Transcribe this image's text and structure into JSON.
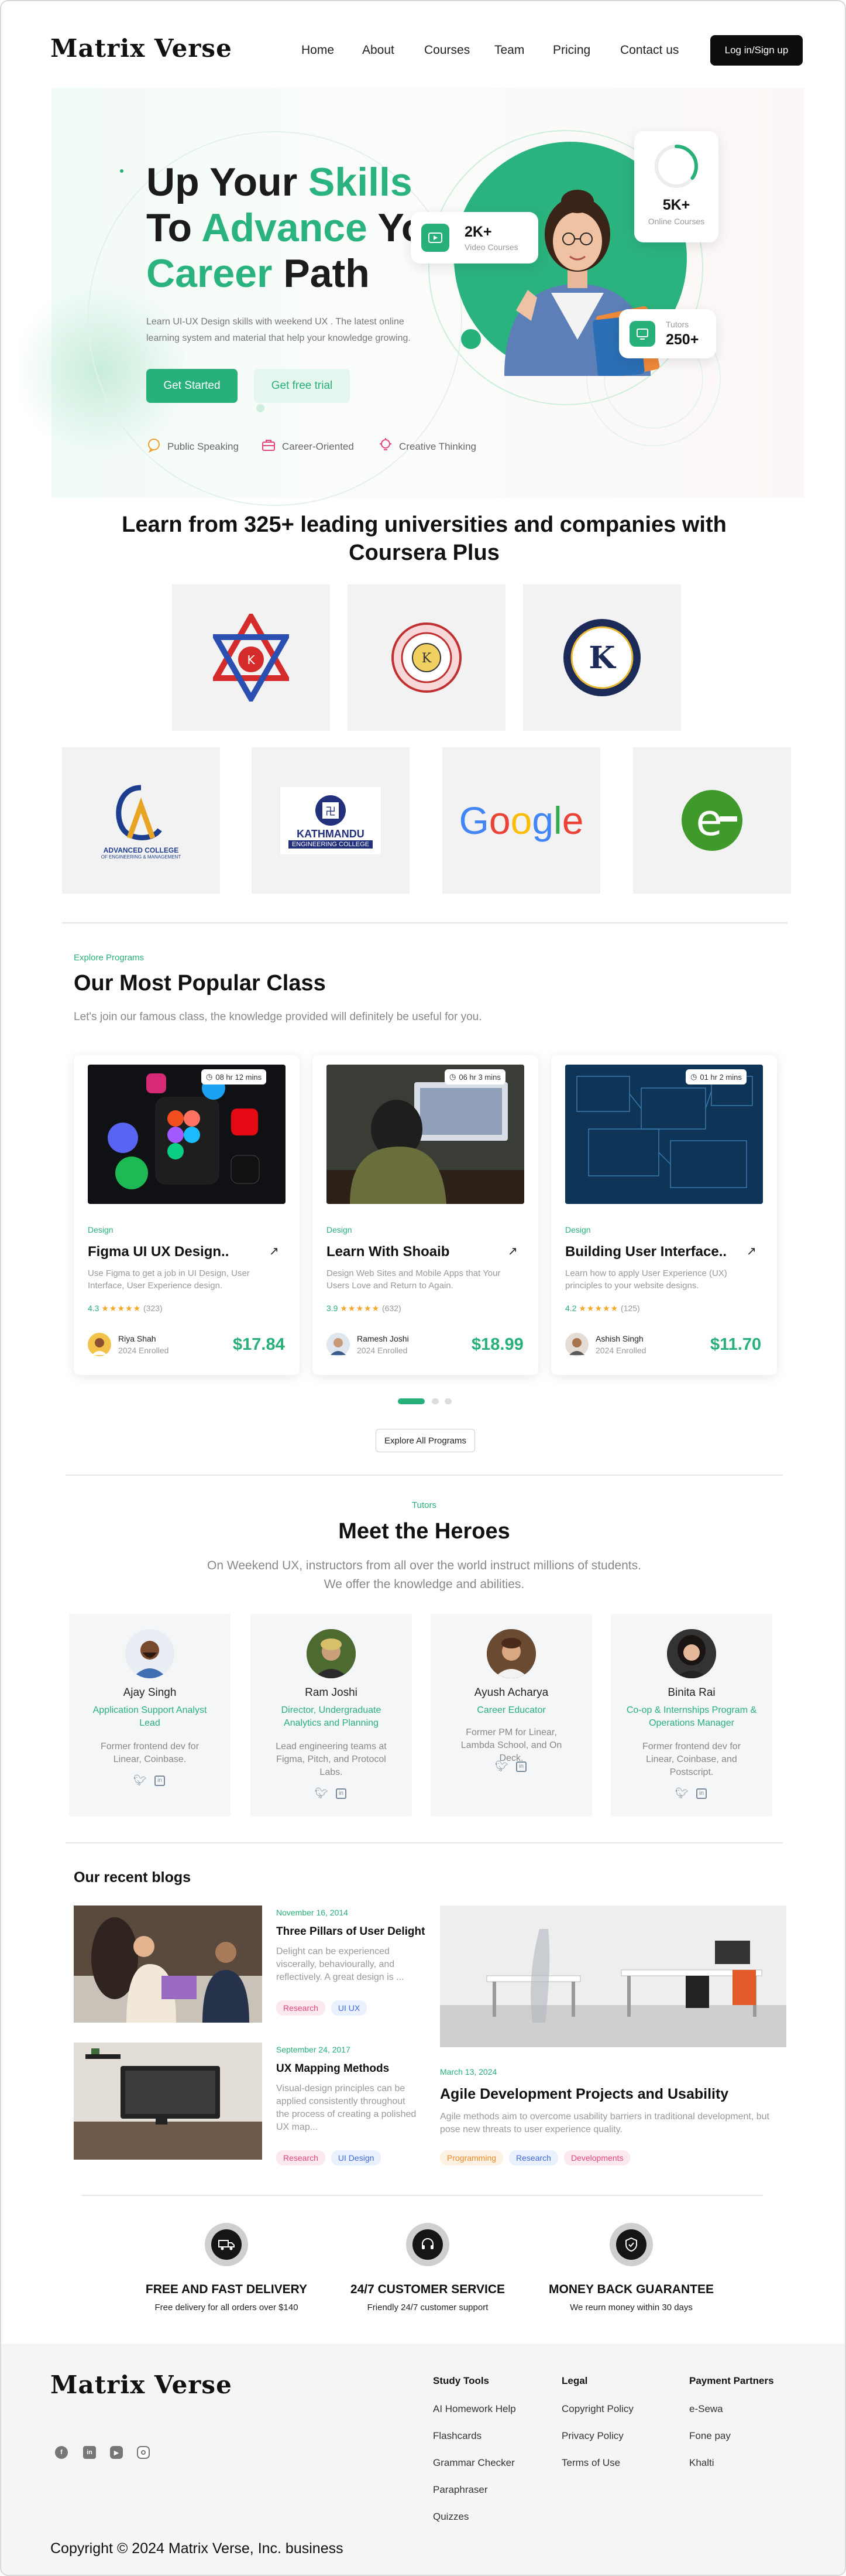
{
  "brand": {
    "logo": "Matrix Verse",
    "accent": "#27b079"
  },
  "nav": {
    "links": [
      "Home",
      "About",
      "Courses",
      "Team",
      "Pricing",
      "Contact us"
    ],
    "login": "Log in/Sign up"
  },
  "hero": {
    "title_l1a": "Up Your ",
    "title_l1b": "Skills",
    "title_l2a": "To ",
    "title_l2b": "Advance",
    "title_l2c": " Your",
    "title_l3a": "Career",
    "title_l3b": " Path",
    "desc": "Learn UI-UX Design skills with weekend UX . The latest online learning system and material that help your knowledge growing.",
    "cta_primary": "Get Started",
    "cta_secondary": "Get free trial",
    "features": [
      "Public Speaking",
      "Career-Oriented",
      "Creative Thinking"
    ],
    "stat_video": {
      "value": "2K+",
      "label": "Video Courses"
    },
    "stat_online": {
      "value": "5K+",
      "label": "Online Courses",
      "progress": 0.35
    },
    "stat_tutors": {
      "value": "250+",
      "label": "Tutors"
    }
  },
  "universities": {
    "title": "Learn from 325+ leading universities and companies with Coursera Plus",
    "logos": [
      "nepal-emblem-logo",
      "university-seal-logo",
      "kantipur-engineering-college-logo",
      "advanced-college-logo",
      "kathmandu-engineering-college-logo",
      "google-logo",
      "e-sewa-logo"
    ],
    "advanced_text": "ADVANCED COLLEGE",
    "advanced_subtext": "OF ENGINEERING & MANAGEMENT",
    "kathmandu_l1": "KATHMANDU",
    "kathmandu_l2": "ENGINEERING COLLEGE",
    "google_text": "Google"
  },
  "programs": {
    "eyebrow": "Explore Programs",
    "title": "Our Most Popular Class",
    "subtitle": "Let's join our famous class, the knowledge provided will definitely be useful for you.",
    "courses": [
      {
        "duration": "08 hr 12 mins",
        "category": "Design",
        "title": "Figma UI UX Design..",
        "desc": "Use Figma to get a job in UI Design, User Interface, User Experience design.",
        "rating": "4.3",
        "stars": "★★★★★",
        "reviews": "(323)",
        "tutor": "Riya Shah",
        "enrolled": "2024 Enrolled",
        "price": "$17.84"
      },
      {
        "duration": "06 hr 3 mins",
        "category": "Design",
        "title": "Learn With Shoaib",
        "desc": "Design Web Sites and Mobile Apps that Your Users Love and Return to Again.",
        "rating": "3.9",
        "stars": "★★★★★",
        "reviews": "(632)",
        "tutor": "Ramesh Joshi",
        "enrolled": "2024 Enrolled",
        "price": "$18.99"
      },
      {
        "duration": "01 hr 2 mins",
        "category": "Design",
        "title": "Building User Interface..",
        "desc": "Learn how to apply User Experience (UX) principles to your website designs.",
        "rating": "4.2",
        "stars": "★★★★★",
        "reviews": "(125)",
        "tutor": "Ashish Singh",
        "enrolled": "2024 Enrolled",
        "price": "$11.70"
      }
    ],
    "explore_btn": "Explore All Programs"
  },
  "tutors": {
    "eyebrow": "Tutors",
    "title": "Meet the Heroes",
    "subtitle_l1": "On Weekend UX, instructors from all over the world instruct millions of students.",
    "subtitle_l2": "We offer the knowledge and abilities.",
    "people": [
      {
        "name": "Ajay Singh",
        "role": "Application Support Analyst Lead",
        "bio": "Former frontend dev for Linear, Coinbase."
      },
      {
        "name": "Ram Joshi",
        "role": "Director, Undergraduate Analytics and Planning",
        "bio": "Lead engineering teams at Figma, Pitch, and Protocol Labs."
      },
      {
        "name": "Ayush Acharya",
        "role": "Career Educator",
        "bio": "Former PM for Linear, Lambda School, and On Deck."
      },
      {
        "name": "Binita Rai",
        "role": "Co-op & Internships Program & Operations Manager",
        "bio": "Former frontend dev for Linear, Coinbase, and Postscript."
      }
    ]
  },
  "blogs": {
    "title": "Our recent blogs",
    "items": [
      {
        "date": "November 16, 2014",
        "title": "Three Pillars of User Delight",
        "desc": "Delight can be experienced viscerally, behaviourally, and reflectively. A great design is ...",
        "tags": [
          "Research",
          "UI UX"
        ]
      },
      {
        "date": "September 24, 2017",
        "title": "UX Mapping Methods",
        "desc": "Visual-design principles can be applied consistently throughout the process of creating a polished UX map...",
        "tags": [
          "Research",
          "UI Design"
        ]
      },
      {
        "date": "March 13, 2024",
        "title": "Agile Development Projects and Usability",
        "desc": "Agile methods aim to overcome usability barriers in traditional development, but pose new threats to user experience quality.",
        "tags": [
          "Programming",
          "Research",
          "Developments"
        ]
      }
    ]
  },
  "services": [
    {
      "icon": "delivery-truck-icon",
      "title": "FREE AND FAST DELIVERY",
      "sub": "Free delivery for all orders over $140"
    },
    {
      "icon": "headset-icon",
      "title": "24/7 CUSTOMER SERVICE",
      "sub": "Friendly 24/7 customer support"
    },
    {
      "icon": "shield-check-icon",
      "title": "MONEY BACK GUARANTEE",
      "sub": "We reurn money within 30 days"
    }
  ],
  "footer": {
    "logo": "Matrix Verse",
    "social": [
      "facebook-icon",
      "linkedin-icon",
      "youtube-icon",
      "instagram-icon"
    ],
    "cols": [
      {
        "head": "Study Tools",
        "links": [
          "AI Homework Help",
          "Flashcards",
          "Grammar Checker",
          "Paraphraser",
          "Quizzes"
        ]
      },
      {
        "head": "Legal",
        "links": [
          "Copyright Policy",
          "Privacy Policy",
          "Terms of Use"
        ]
      },
      {
        "head": "Payment Partners",
        "links": [
          "e-Sewa",
          "Fone pay",
          "Khalti"
        ]
      }
    ],
    "copyright": "Copyright © 2024 Matrix Verse, Inc. business"
  }
}
